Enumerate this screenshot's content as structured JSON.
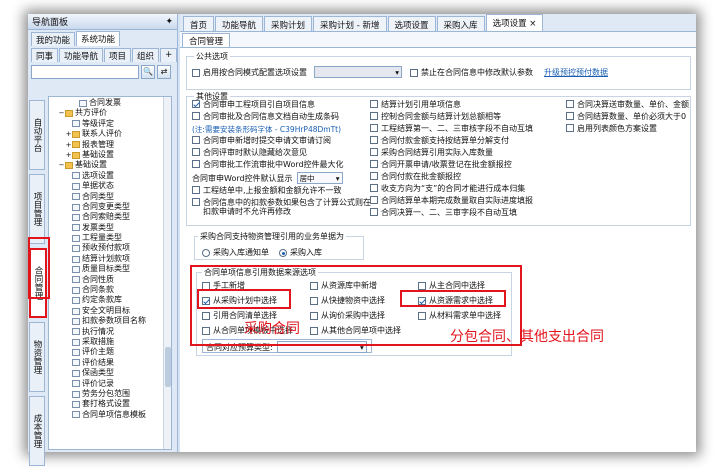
{
  "left_panel": {
    "title": "导航面板",
    "pin": "✦",
    "tabs_row1": [
      "我的功能",
      "系统功能"
    ],
    "tabs_row2": [
      "同事",
      "功能导航",
      "项目",
      "组织",
      "+"
    ],
    "vertical_tabs": [
      "自动平台",
      "项目管理",
      "合同管理",
      "物资管理",
      "成本管理"
    ],
    "tree": [
      {
        "label": "合同发票",
        "level": 3,
        "type": "doc"
      },
      {
        "label": "共方评价",
        "level": 1,
        "type": "folder",
        "expand": "−"
      },
      {
        "label": "等级评定",
        "level": 2,
        "type": "doc"
      },
      {
        "label": "联系人评价",
        "level": 2,
        "type": "folder",
        "expand": "+"
      },
      {
        "label": "报表管理",
        "level": 2,
        "type": "folder",
        "expand": "+"
      },
      {
        "label": "基础设置",
        "level": 2,
        "type": "folder",
        "expand": "+"
      },
      {
        "label": "基础设置",
        "level": 1,
        "type": "folder",
        "expand": "−"
      },
      {
        "label": "选项设置",
        "level": 2,
        "type": "doc"
      },
      {
        "label": "单据状态",
        "level": 2,
        "type": "doc"
      },
      {
        "label": "合同类型",
        "level": 2,
        "type": "doc"
      },
      {
        "label": "合同变更类型",
        "level": 2,
        "type": "doc"
      },
      {
        "label": "合同索赔类型",
        "level": 2,
        "type": "doc"
      },
      {
        "label": "发票类型",
        "level": 2,
        "type": "doc"
      },
      {
        "label": "工程量类型",
        "level": 2,
        "type": "doc"
      },
      {
        "label": "预收预付款项",
        "level": 2,
        "type": "doc"
      },
      {
        "label": "结算计划款项",
        "level": 2,
        "type": "doc"
      },
      {
        "label": "质量目标类型",
        "level": 2,
        "type": "doc"
      },
      {
        "label": "合同性质",
        "level": 2,
        "type": "doc"
      },
      {
        "label": "合同条款",
        "level": 2,
        "type": "doc"
      },
      {
        "label": "约定条款库",
        "level": 2,
        "type": "doc"
      },
      {
        "label": "安全文明目标",
        "level": 2,
        "type": "doc"
      },
      {
        "label": "扣款参数项目名称",
        "level": 2,
        "type": "doc"
      },
      {
        "label": "执行情况",
        "level": 2,
        "type": "doc"
      },
      {
        "label": "采取措施",
        "level": 2,
        "type": "doc"
      },
      {
        "label": "评价主题",
        "level": 2,
        "type": "doc"
      },
      {
        "label": "评价结果",
        "level": 2,
        "type": "doc"
      },
      {
        "label": "保函类型",
        "level": 2,
        "type": "doc"
      },
      {
        "label": "评价记录",
        "level": 2,
        "type": "doc"
      },
      {
        "label": "劳务分包范围",
        "level": 2,
        "type": "doc"
      },
      {
        "label": "套打格式设置",
        "level": 2,
        "type": "doc"
      },
      {
        "label": "合同单项信息模板",
        "level": 2,
        "type": "doc"
      }
    ]
  },
  "top_tabs": [
    "首页",
    "功能导航",
    "采购计划",
    "采购计划 - 新增",
    "选项设置",
    "采购入库",
    "选项设置 ×"
  ],
  "sub_tab": "合同管理",
  "public": {
    "group": "公共选项",
    "enable_mode": "启用按合同模式配置选项设置",
    "disable_default": "禁止在合同信息中修改默认参数",
    "upgrade_link": "升级预控预付数据"
  },
  "other": {
    "group": "其他设置",
    "col1": [
      {
        "label": "合同审申工程项目引自项目信息",
        "checked": true
      },
      {
        "label": "合同审批及合同信息文档自动生成条码",
        "checked": false
      },
      {
        "label": "(注:需要安装条形码字体 - C39HrP48DmTt)",
        "note": true
      },
      {
        "label": "合同审申新增时提交申请文审请订阅",
        "checked": false
      },
      {
        "label": "合同评审时默认隐藏给次意见",
        "checked": false
      },
      {
        "label": "合同审批工作流审批中Word控件最大化",
        "checked": false
      }
    ],
    "word_default_label": "合同审申Word控件默认显示",
    "word_default_value": "居中",
    "col1b": [
      {
        "label": "工程结单中,上报金额和金额允许不一致",
        "checked": false
      },
      {
        "label": "合同信息中的扣款参数如果包含了计算公式则在扣款申请时不允许再修改",
        "checked": false
      }
    ],
    "col2": [
      {
        "label": "结算计划引用单项信息",
        "checked": false
      },
      {
        "label": "控制合同金额与结算计划总额相等",
        "checked": false
      },
      {
        "label": "工程结算第一、二、三审核字段不自动互填",
        "checked": false
      },
      {
        "label": "合同付款金额支持按结算单分解支付",
        "checked": false
      },
      {
        "label": "采购合同结算引用实际入库数量",
        "checked": false
      },
      {
        "label": "合同开票申请/收票登记在批金额报控",
        "checked": false
      },
      {
        "label": "合同付款在批金额报控",
        "checked": false
      },
      {
        "label": "收支方向为“支”的合同才能进行成本归集",
        "checked": false
      },
      {
        "label": "合同结算单本期完成数量取自实际进度填报",
        "checked": false
      },
      {
        "label": "合同决算一、二、三审字段不自动互填",
        "checked": false
      }
    ],
    "col3": [
      {
        "label": "合同决算送审数量、单价、金额",
        "checked": false
      },
      {
        "label": "合同结算数量、单价必须大于0",
        "checked": false
      },
      {
        "label": "启用列表颜色方案设置",
        "checked": false
      }
    ]
  },
  "purchase": {
    "group": "采购合同支持物资管理引用的业务单据为",
    "options": [
      {
        "label": "采购入库通知单",
        "checked": false
      },
      {
        "label": "采购入库",
        "checked": true
      }
    ]
  },
  "source": {
    "group": "合同单项信息引用数据来源选项",
    "items": [
      {
        "label": "手工新增",
        "checked": false
      },
      {
        "label": "从资源库中新增",
        "checked": false
      },
      {
        "label": "从主合同中选择",
        "checked": false
      },
      {
        "label": "从采购计划中选择",
        "checked": true
      },
      {
        "label": "从快捷物资中选择",
        "checked": false
      },
      {
        "label": "从资源需求中选择",
        "checked": true
      },
      {
        "label": "引用合同清单选择",
        "checked": false
      },
      {
        "label": "从询价采购中选择",
        "checked": false
      },
      {
        "label": "从材料需求单中选择",
        "checked": false
      },
      {
        "label": "从合同单项模板中选择",
        "checked": false
      },
      {
        "label": "从其他合同单项中选择",
        "checked": false
      }
    ],
    "budget_label": "合同对应预算类型:"
  },
  "annotations": {
    "purchase_contract": "采购合同",
    "sub_contract": "分包合同、其他支出合同"
  },
  "colors": {
    "highlight": "#e2141c",
    "link": "#1a5fb4"
  }
}
